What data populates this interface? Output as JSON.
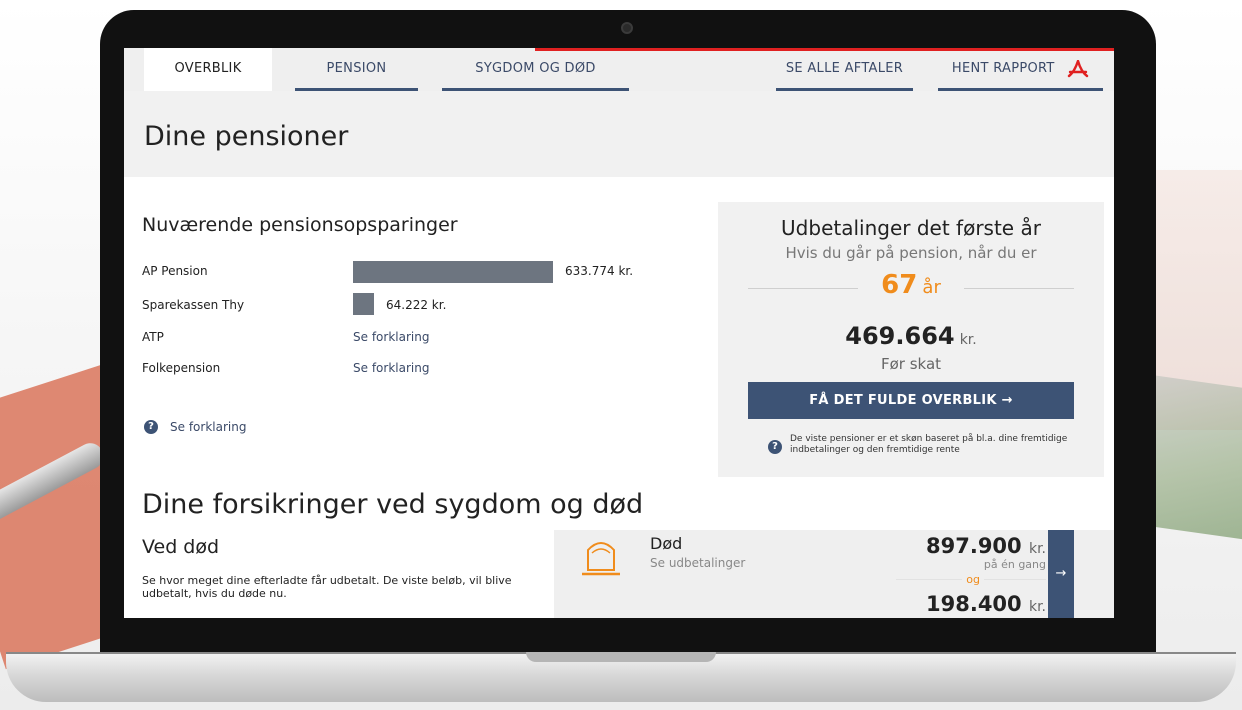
{
  "nav": {
    "tabs": [
      "OVERBLIK",
      "PENSION",
      "SYGDOM OG DØD"
    ],
    "right_tabs": [
      "SE ALLE AFTALER",
      "HENT RAPPORT"
    ]
  },
  "hero": {
    "title": "Dine pensioner"
  },
  "savings": {
    "title": "Nuværende pensionsopsparinger",
    "rows": [
      {
        "label": "AP Pension",
        "value": "633.774 kr.",
        "amount": 633774
      },
      {
        "label": "Sparekassen Thy",
        "value": "64.222 kr.",
        "amount": 64222
      },
      {
        "label": "ATP",
        "value": "Se forklaring"
      },
      {
        "label": "Folkepension",
        "value": "Se forklaring"
      }
    ],
    "help_link": "Se forklaring"
  },
  "payout": {
    "title": "Udbetalinger det første år",
    "subtitle": "Hvis du går på pension, når du er",
    "age": "67",
    "age_unit": "år",
    "amount": "469.664",
    "amount_unit": "kr.",
    "tax_note": "Før skat",
    "button": "FÅ DET FULDE OVERBLIK →",
    "note": "De viste pensioner er et skøn baseret på bl.a. dine fremtidige indbetalinger og den fremtidige rente"
  },
  "insurance": {
    "title": "Dine forsikringer ved sygdom og død",
    "death_section_title": "Ved død",
    "death_section_text": "Se hvor meget dine efterladte får udbetalt. De viste beløb, vil blive udbetalt, hvis du døde nu.",
    "card": {
      "label": "Død",
      "link": "Se udbetalinger",
      "amount1": "897.900",
      "unit": "kr.",
      "once_label": "på én gang",
      "og_label": "og",
      "amount2": "198.400",
      "arrow": "→"
    }
  },
  "colors": {
    "accent": "#3d5375",
    "highlight": "#f08c1c",
    "top_bar": "#e02121"
  }
}
